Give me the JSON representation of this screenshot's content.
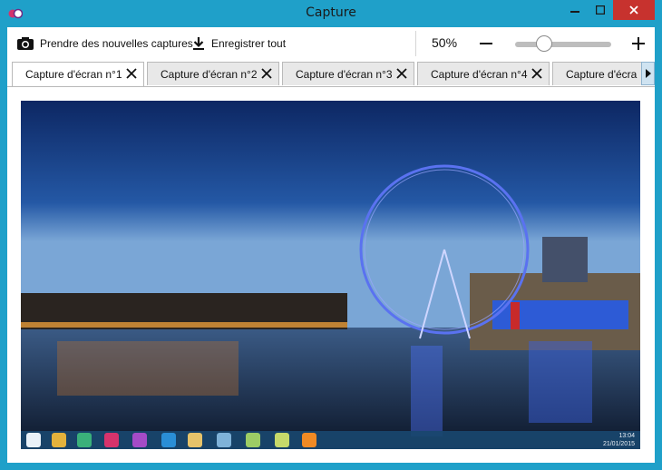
{
  "window": {
    "title": "Capture",
    "accent": "#1fa0c9",
    "close_color": "#c7322e"
  },
  "toolbar": {
    "capture_label": "Prendre des nouvelles captures",
    "capture_icon": "camera-icon",
    "save_label": "Enregistrer tout",
    "save_icon": "download-icon",
    "zoom_value": "50%",
    "zoom_level": 0.5,
    "minus_icon": "minus-icon",
    "plus_icon": "plus-icon"
  },
  "tabs": [
    {
      "label": "Capture d'écran n°1",
      "active": true
    },
    {
      "label": "Capture d'écran n°2",
      "active": false
    },
    {
      "label": "Capture d'écran n°3",
      "active": false
    },
    {
      "label": "Capture d'écran n°4",
      "active": false
    },
    {
      "label": "Capture d'écra",
      "active": false
    }
  ],
  "preview": {
    "taskbar_time": "13:04",
    "taskbar_date": "21/01/2015"
  }
}
